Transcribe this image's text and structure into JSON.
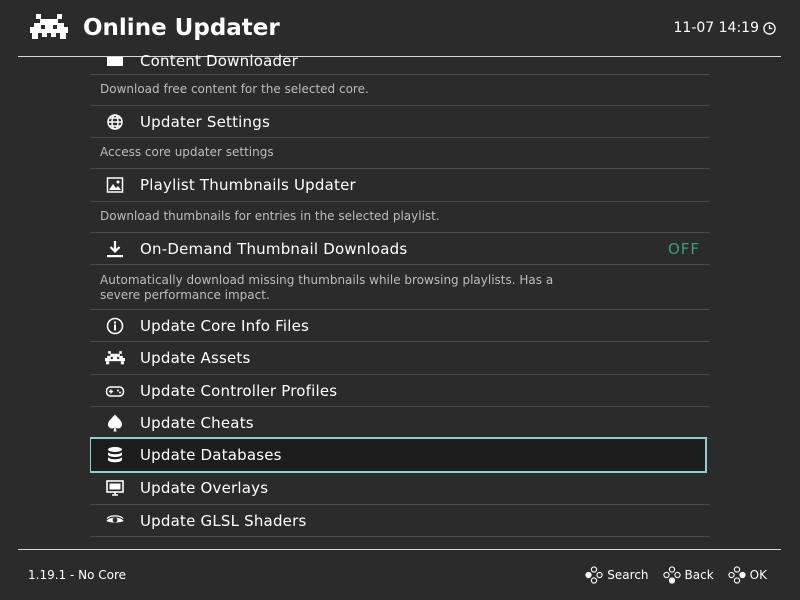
{
  "header": {
    "title": "Online Updater",
    "clock": "11-07 14:19",
    "logo_icon": "space-invader-icon",
    "clock_icon": "clock-icon"
  },
  "menu": {
    "items": [
      {
        "label": "Content Downloader",
        "description": "Download free content for the selected core.",
        "icon": "box-icon"
      },
      {
        "label": "Updater Settings",
        "description": "Access core updater settings",
        "icon": "globe-icon"
      },
      {
        "label": "Playlist Thumbnails Updater",
        "description": "Download thumbnails for entries in the selected playlist.",
        "icon": "image-icon"
      },
      {
        "label": "On-Demand Thumbnail Downloads",
        "value": "OFF",
        "description": "Automatically download missing thumbnails while browsing playlists. Has a severe performance impact.",
        "icon": "download-icon"
      },
      {
        "label": "Update Core Info Files",
        "icon": "info-icon"
      },
      {
        "label": "Update Assets",
        "icon": "space-invader-icon"
      },
      {
        "label": "Update Controller Profiles",
        "icon": "gamepad-icon"
      },
      {
        "label": "Update Cheats",
        "icon": "spade-icon"
      },
      {
        "label": "Update Databases",
        "icon": "database-icon",
        "selected": true
      },
      {
        "label": "Update Overlays",
        "icon": "monitor-icon"
      },
      {
        "label": "Update GLSL Shaders",
        "icon": "eye-icon"
      }
    ]
  },
  "footer": {
    "version": "1.19.1 - No Core",
    "buttons": [
      {
        "label": "Search",
        "icon": "gamepad-buttons-icon"
      },
      {
        "label": "Back",
        "icon": "gamepad-buttons-icon"
      },
      {
        "label": "OK",
        "icon": "gamepad-buttons-icon"
      }
    ]
  },
  "colors": {
    "background": "#2b2b2b",
    "selection_border": "#8ecfd0",
    "value_off": "#3aa17a",
    "description": "#bdbdbd"
  }
}
